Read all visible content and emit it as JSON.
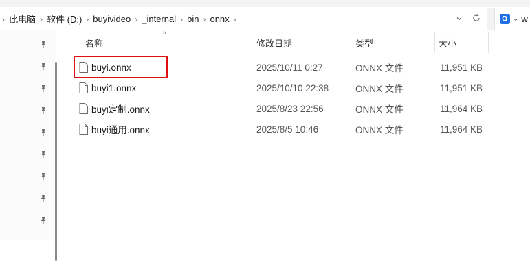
{
  "breadcrumb": [
    "此电脑",
    "软件 (D:)",
    "buyivideo",
    "_internal",
    "bin",
    "onnx"
  ],
  "search": {
    "text": "w"
  },
  "columns": {
    "name": "名称",
    "date": "修改日期",
    "type": "类型",
    "size": "大小"
  },
  "files": [
    {
      "name": "buyi.onnx",
      "date": "2025/10/11 0:27",
      "type": "ONNX 文件",
      "size": "11,951 KB"
    },
    {
      "name": "buyi1.onnx",
      "date": "2025/10/10 22:38",
      "type": "ONNX 文件",
      "size": "11,951 KB"
    },
    {
      "name": "buyi定制.onnx",
      "date": "2025/8/23 22:56",
      "type": "ONNX 文件",
      "size": "11,964 KB"
    },
    {
      "name": "buyi通用.onnx",
      "date": "2025/8/5 10:46",
      "type": "ONNX 文件",
      "size": "11,964 KB"
    }
  ],
  "colors": {
    "highlight": "#e01010",
    "search_badge": "#1f6fe5"
  }
}
